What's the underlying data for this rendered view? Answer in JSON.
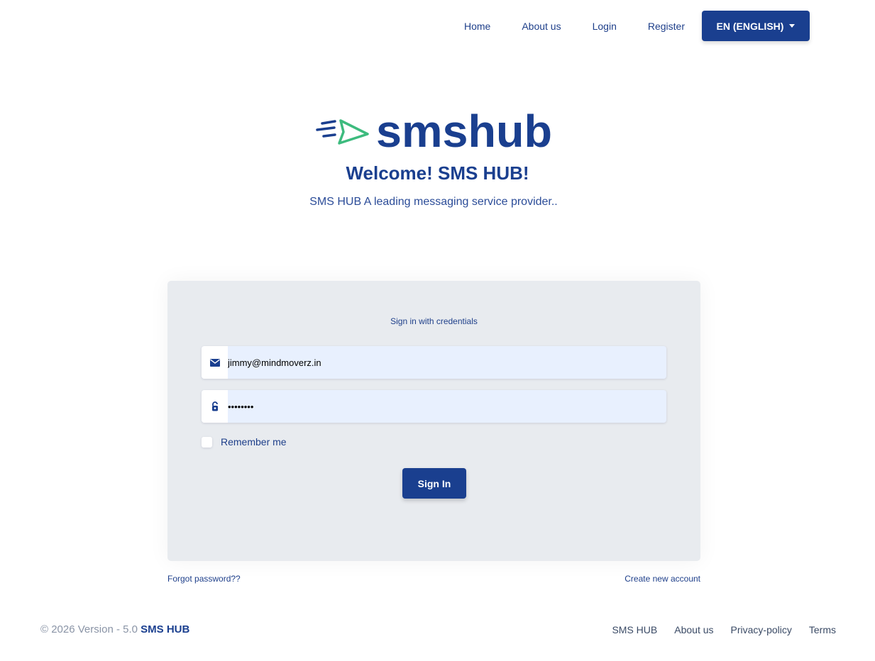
{
  "nav": {
    "links": [
      "Home",
      "About us",
      "Login",
      "Register"
    ],
    "language_label": "EN (ENGLISH)"
  },
  "brand": {
    "logo_text": "smshub",
    "welcome": "Welcome! SMS HUB!",
    "tagline": "SMS HUB A leading messaging service provider.."
  },
  "login": {
    "title": "Sign in with credentials",
    "email_value": "jimmy@mindmoverz.in",
    "password_value": "••••••••",
    "remember_label": "Remember me",
    "signin_label": "Sign In"
  },
  "links": {
    "forgot": "Forgot password??",
    "create": "Create new account"
  },
  "footer": {
    "copyright": "© 2026 Version - 5.0",
    "brand": "SMS HUB",
    "links": [
      "SMS HUB",
      "About us",
      "Privacy-policy",
      "Terms"
    ]
  },
  "colors": {
    "primary": "#1a3f8f",
    "logo_green": "#3dbb7e",
    "card_bg": "#e8ebef",
    "input_bg": "#e8f0fe"
  },
  "icons": [
    "envelope-icon",
    "lock-icon",
    "caret-down-icon",
    "paper-plane-icon"
  ]
}
